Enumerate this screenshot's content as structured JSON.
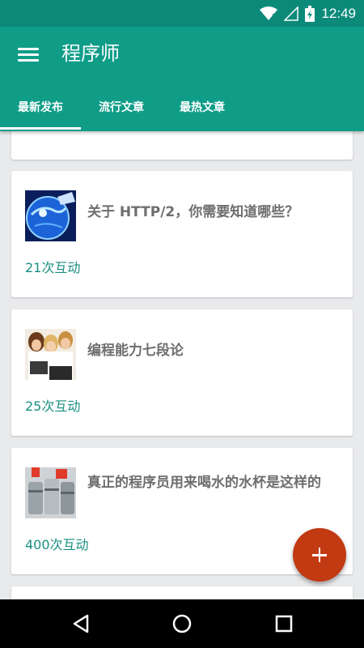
{
  "status_bar": {
    "time": "12:49"
  },
  "app_bar": {
    "title": "程序师"
  },
  "tabs": [
    {
      "label": "最新发布",
      "active": true
    },
    {
      "label": "流行文章",
      "active": false
    },
    {
      "label": "最热文章",
      "active": false
    }
  ],
  "articles": [
    {
      "title": "关于 HTTP/2，你需要知道哪些？",
      "interactions": "21次互动",
      "thumbnail": "globe-network-image"
    },
    {
      "title": "编程能力七段论",
      "interactions": "25次互动",
      "thumbnail": "people-at-laptop-image"
    },
    {
      "title": "真正的程序员用来喝水的水杯是这样的",
      "interactions": "400次互动",
      "thumbnail": "metal-cups-image"
    }
  ],
  "fab": {
    "icon": "plus-icon"
  },
  "colors": {
    "primary": "#0f9d88",
    "primary_dark": "#0b8a7a",
    "accent": "#c23a12",
    "interaction_text": "#1b8f83"
  }
}
